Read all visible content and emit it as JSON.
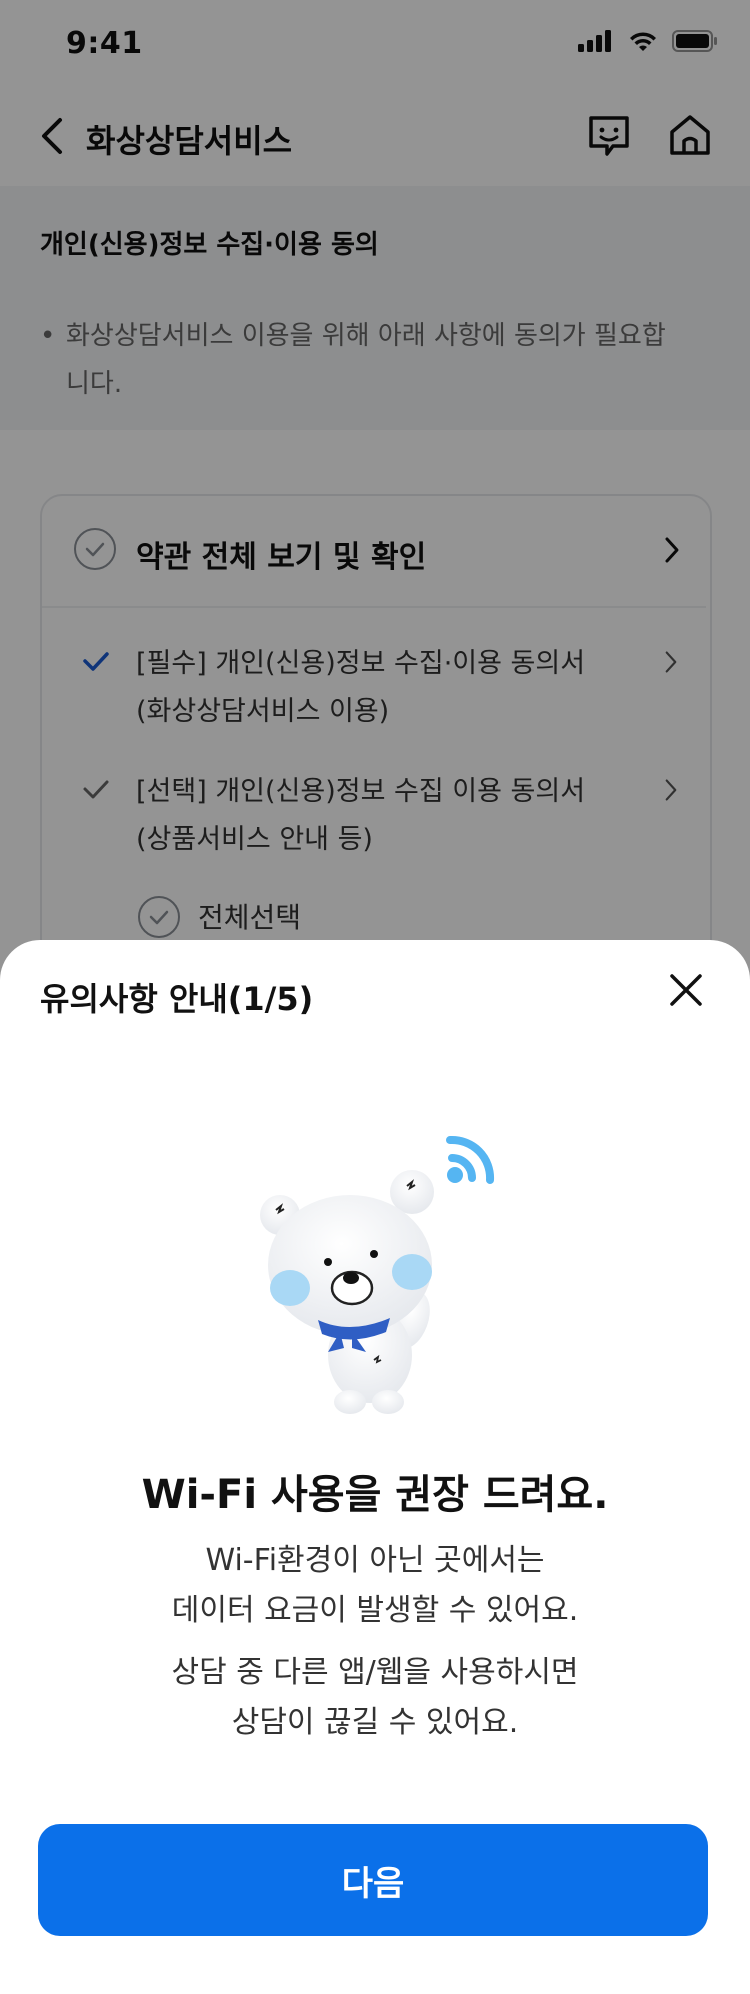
{
  "status": {
    "time": "9:41"
  },
  "nav": {
    "title": "화상상담서비스"
  },
  "section_title": "개인(신용)정보 수집·이용 동의",
  "notice": {
    "bullet": "•",
    "line1": "화상상담서비스 이용을 위해 아래 사항에 동의가 필요합",
    "line2": "니다."
  },
  "agreement_card": {
    "title": "약관 전체 보기 및 확인",
    "items": [
      {
        "line1": "[필수] 개인(신용)정보 수집·이용 동의서",
        "line2": "(화상상담서비스 이용)"
      },
      {
        "line1": "[선택] 개인(신용)정보 수집 이용 동의서",
        "line2": "(상품서비스 안내 등)"
      }
    ],
    "select_all": "전체선택"
  },
  "sheet": {
    "title": "유의사항 안내(1/5)",
    "headline": "Wi-Fi 사용을 권장 드려요.",
    "desc1": {
      "line1": "Wi-Fi환경이 아닌 곳에서는",
      "line2": "데이터 요금이 발생할 수 있어요."
    },
    "desc2": {
      "line1": "상담 중 다른 앱/웹을 사용하시면",
      "line2": "상담이 끊길 수 있어요."
    },
    "next_label": "다음"
  },
  "colors": {
    "primary": "#0b70e9",
    "check_required": "#1a5bd1",
    "wifi": "#55b5f2",
    "scarf": "#2f5ec4",
    "cheek": "#a9d8f5"
  }
}
